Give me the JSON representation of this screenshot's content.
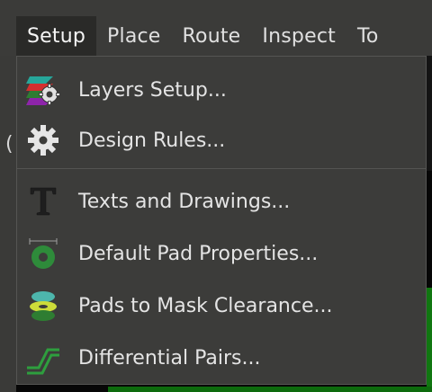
{
  "menubar": {
    "items": [
      {
        "label": "Setup",
        "active": true
      },
      {
        "label": "Place"
      },
      {
        "label": "Route"
      },
      {
        "label": "Inspect"
      },
      {
        "label": "To"
      }
    ]
  },
  "dropdown": {
    "items": [
      {
        "label": "Layers Setup...",
        "icon": "layers-setup-icon"
      },
      {
        "label": "Design Rules...",
        "icon": "gear-icon"
      },
      {
        "label": "Texts and Drawings...",
        "icon": "text-t-icon"
      },
      {
        "label": "Default Pad Properties...",
        "icon": "pad-icon"
      },
      {
        "label": "Pads to Mask Clearance...",
        "icon": "mask-clearance-icon"
      },
      {
        "label": "Differential Pairs...",
        "icon": "differential-pairs-icon"
      }
    ]
  },
  "background": {
    "side_glyph": "("
  },
  "colors": {
    "menu_bg": "#3c3c3a",
    "menubar_bg": "#3b3b39",
    "text": "#e4e4e4",
    "pcb_green": "#117711"
  }
}
